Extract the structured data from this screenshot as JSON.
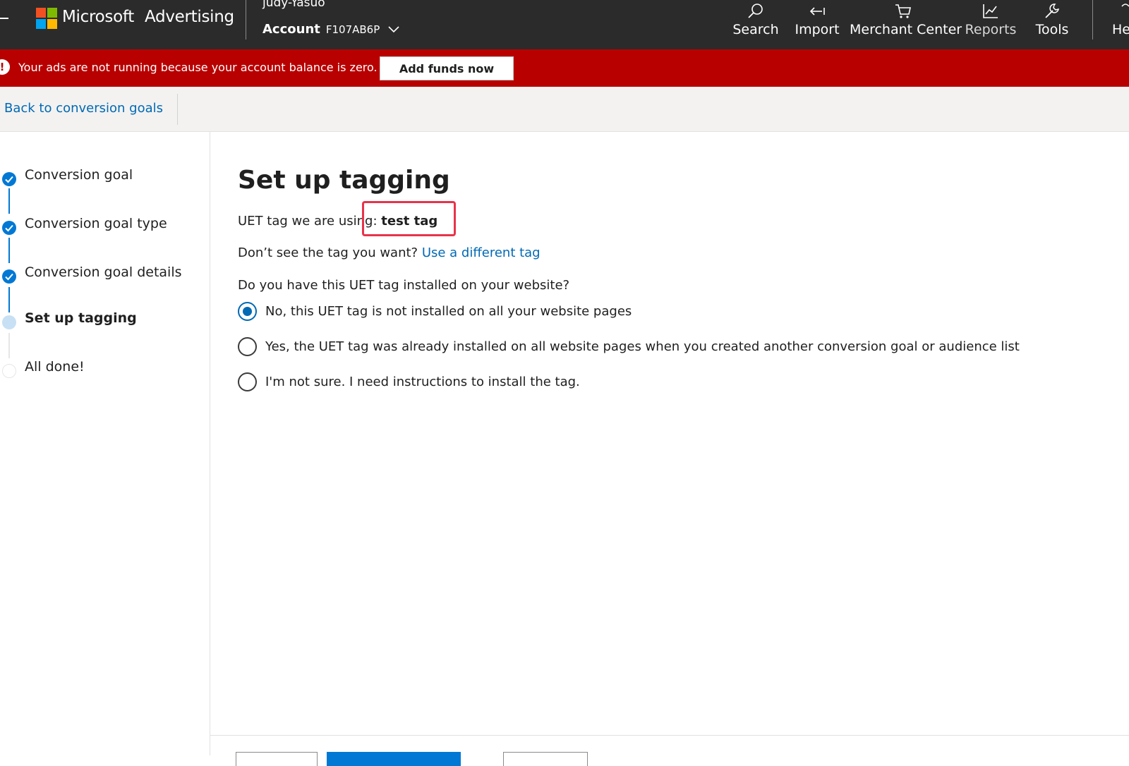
{
  "header": {
    "brand_microsoft": "Microsoft",
    "brand_advertising": "Advertising",
    "account_name": "judy-Yasuo",
    "account_label": "Account",
    "account_id": "F107AB6P",
    "nav": [
      {
        "label": "Search",
        "icon": "search-icon"
      },
      {
        "label": "Import",
        "icon": "import-icon"
      },
      {
        "label": "Merchant Center",
        "icon": "cart-icon"
      },
      {
        "label": "Reports",
        "icon": "chart-icon"
      },
      {
        "label": "Tools",
        "icon": "wrench-icon"
      },
      {
        "label": "He",
        "icon": "help-icon"
      }
    ]
  },
  "alert": {
    "icon": "!",
    "message": "Your ads are not running because your account balance is zero.",
    "button_label": "Add funds now"
  },
  "back_bar": {
    "link_label": "Back to conversion goals"
  },
  "steps": [
    {
      "label": "Conversion goal",
      "state": "complete"
    },
    {
      "label": "Conversion goal type",
      "state": "complete"
    },
    {
      "label": "Conversion goal details",
      "state": "complete"
    },
    {
      "label": "Set up tagging",
      "state": "current"
    },
    {
      "label": "All done!",
      "state": "pending"
    }
  ],
  "main": {
    "title": "Set up tagging",
    "uet_prefix": "UET tag we are using:",
    "uet_tag_name": "test tag",
    "dont_see_text": "Don’t see the tag you want?",
    "different_tag_link": "Use a different tag",
    "question": "Do you have this UET tag installed on your website?",
    "options": [
      {
        "label": "No, this UET tag is not installed on all your website pages",
        "selected": true
      },
      {
        "label": "Yes, the UET tag was already installed on all website pages when you created another conversion goal or audience list",
        "selected": false
      },
      {
        "label": "I'm not sure. I need instructions to install the tag.",
        "selected": false
      }
    ]
  },
  "colors": {
    "topbar": "#2b2b2b",
    "alert": "#b80000",
    "link": "#0069b4",
    "step_complete": "#0078d4",
    "step_current": "#c7e0f4",
    "highlight": "#e8334a"
  }
}
